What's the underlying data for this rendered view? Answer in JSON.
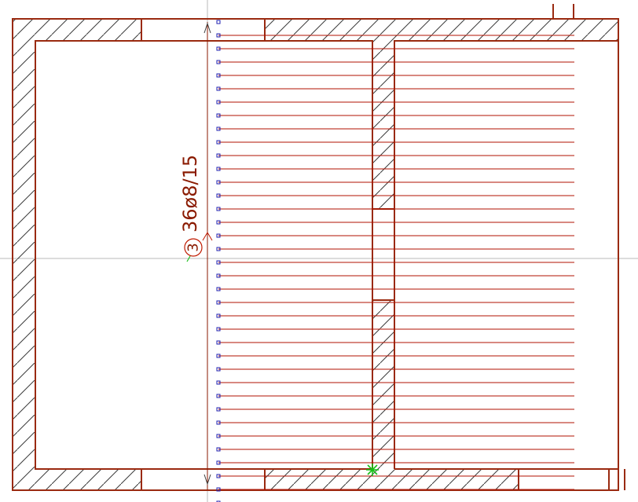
{
  "app": {
    "view": "reinforcement-plan-drawing"
  },
  "colors": {
    "wall": "#9a2a10",
    "hatch": "#3a3a3a",
    "bar": "#b01000",
    "marker": "#2020b0",
    "crosshair": "#b8b8b8",
    "snap": "#18c018",
    "label": "#8a1a00"
  },
  "rebar": {
    "position_number": "3",
    "label": "36ø8/15",
    "bar_count": 36
  },
  "icons": {
    "snap": "snap-star-icon",
    "arrow_top": "dimension-arrow-up-icon",
    "arrow_bottom": "dimension-arrow-down-icon"
  }
}
